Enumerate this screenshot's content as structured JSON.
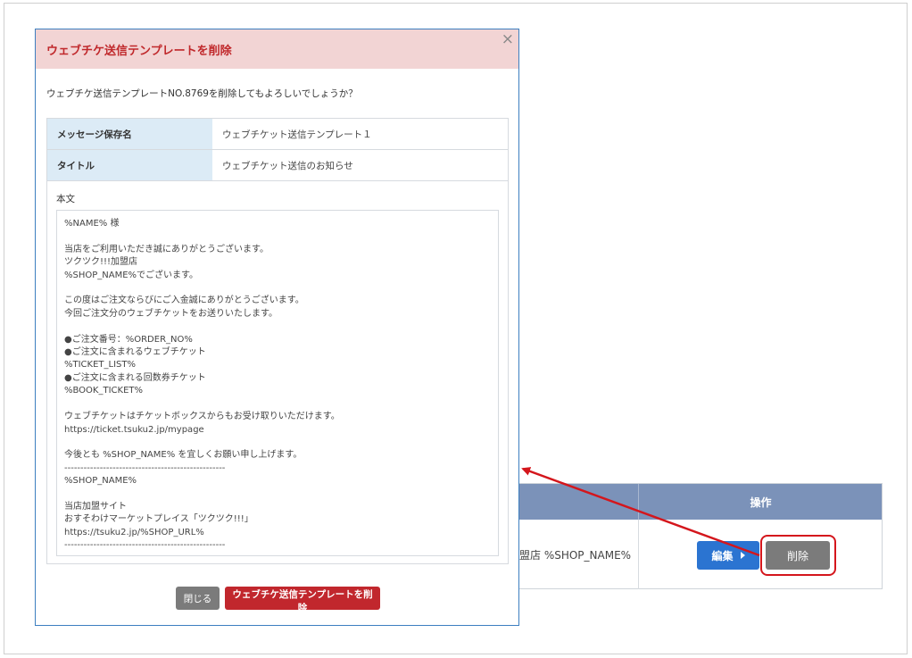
{
  "background_table": {
    "header_ops": "操作",
    "shop_cell": "盟店 %SHOP_NAME%",
    "edit_label": "編集",
    "delete_label": "削除"
  },
  "modal": {
    "title": "ウェブチケ送信テンプレートを削除",
    "close_symbol": "×",
    "confirm_text": "ウェブチケ送信テンプレートNO.8769を削除してもよろしいでしょうか？",
    "rows": [
      {
        "label": "メッセージ保存名",
        "value": "ウェブチケット送信テンプレート１"
      },
      {
        "label": "タイトル",
        "value": "ウェブチケット送信のお知らせ"
      }
    ],
    "body_label": "本文",
    "body_text": "%NAME% 様\n\n当店をご利用いただき誠にありがとうございます。\nツクツク!!!加盟店\n%SHOP_NAME%でございます。\n\nこの度はご注文ならびにご入金誠にありがとうございます。\n今回ご注文分のウェブチケットをお送りいたします。\n\n●ご注文番号：%ORDER_NO%\n●ご注文に含まれるウェブチケット\n%TICKET_LIST%\n●ご注文に含まれる回数券チケット\n%BOOK_TICKET%\n\nウェブチケットはチケットボックスからもお受け取りいただけます。\nhttps://ticket.tsuku2.jp/mypage\n\n今後とも %SHOP_NAME% を宜しくお願い申し上げます。\n--------------------------------------------------\n%SHOP_NAME%\n\n当店加盟サイト\nおすそわけマーケットプレイス「ツクツク!!!」\nhttps://tsuku2.jp/%SHOP_URL%\n--------------------------------------------------",
    "close_button": "閉じる",
    "delete_button": "ウェブチケ送信テンプレートを削除"
  },
  "colors": {
    "header_bg": "#f2d4d4",
    "title_red": "#c0282b",
    "label_bg": "#dcebf6",
    "table_head": "#7b92b9",
    "edit_blue": "#2b74d1",
    "annotation_red": "#d4161c"
  }
}
